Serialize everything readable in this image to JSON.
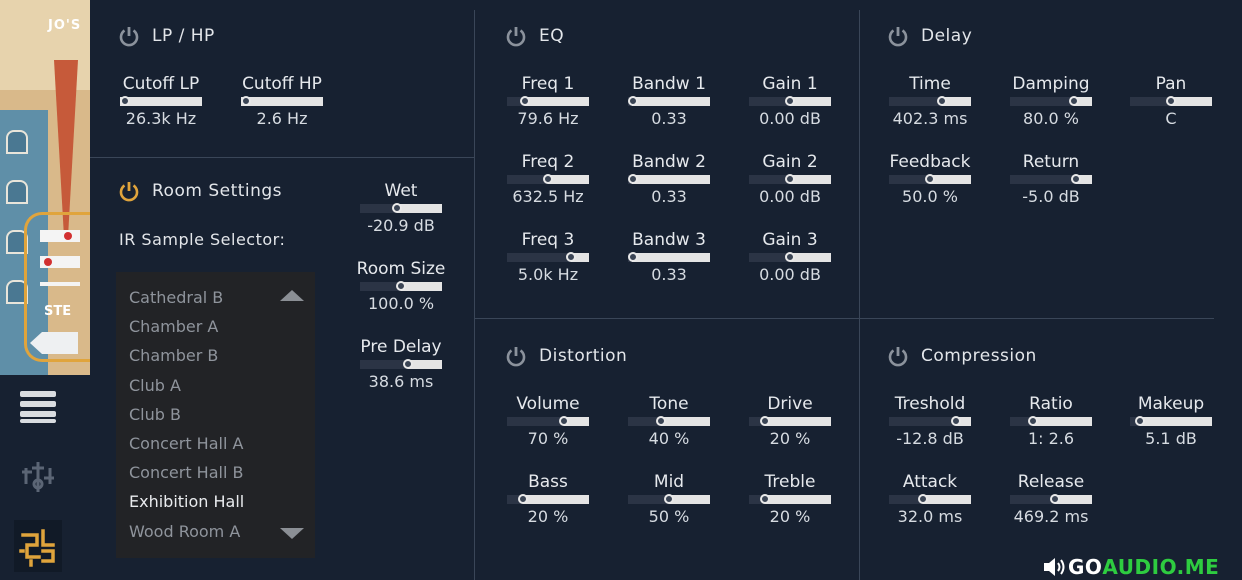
{
  "artwork": {
    "top_text": "JO'S",
    "sign_text": "STE"
  },
  "lp_hp": {
    "title": "LP / HP",
    "params": [
      {
        "label": "Cutoff LP",
        "value": "26.3k Hz",
        "level": 0.0
      },
      {
        "label": "Cutoff HP",
        "value": "2.6 Hz",
        "level": 0.0
      }
    ]
  },
  "room": {
    "title": "Room Settings",
    "ir_label": "IR Sample Selector:",
    "ir_items": [
      "Cathedral B",
      "Chamber A",
      "Chamber B",
      "Club A",
      "Club B",
      "Concert Hall A",
      "Concert Hall B",
      "Exhibition Hall",
      "Wood Room A"
    ],
    "ir_selected": "Exhibition Hall",
    "params": [
      {
        "label": "Wet",
        "value": "-20.9 dB",
        "level": 0.45
      },
      {
        "label": "Room Size",
        "value": "100.0 %",
        "level": 0.5
      },
      {
        "label": "Pre Delay",
        "value": "38.6 ms",
        "level": 0.58
      }
    ]
  },
  "eq": {
    "title": "EQ",
    "params": [
      {
        "label": "Freq 1",
        "value": "79.6 Hz",
        "level": 0.22
      },
      {
        "label": "Bandw 1",
        "value": "0.33",
        "level": 0.05
      },
      {
        "label": "Gain 1",
        "value": "0.00 dB",
        "level": 0.5
      },
      {
        "label": "Freq 2",
        "value": "632.5 Hz",
        "level": 0.5
      },
      {
        "label": "Bandw 2",
        "value": "0.33",
        "level": 0.05
      },
      {
        "label": "Gain 2",
        "value": "0.00 dB",
        "level": 0.5
      },
      {
        "label": "Freq 3",
        "value": "5.0k Hz",
        "level": 0.78
      },
      {
        "label": "Bandw 3",
        "value": "0.33",
        "level": 0.05
      },
      {
        "label": "Gain 3",
        "value": "0.00 dB",
        "level": 0.5
      }
    ]
  },
  "delay": {
    "title": "Delay",
    "params": [
      {
        "label": "Time",
        "value": "402.3 ms",
        "level": 0.65
      },
      {
        "label": "Damping",
        "value": "80.0 %",
        "level": 0.78
      },
      {
        "label": "Pan",
        "value": "C",
        "level": 0.5
      },
      {
        "label": "Feedback",
        "value": "50.0 %",
        "level": 0.5
      },
      {
        "label": "Return",
        "value": "-5.0 dB",
        "level": 0.8
      }
    ]
  },
  "distortion": {
    "title": "Distortion",
    "params": [
      {
        "label": "Volume",
        "value": "70 %",
        "level": 0.7
      },
      {
        "label": "Tone",
        "value": "40 %",
        "level": 0.4
      },
      {
        "label": "Drive",
        "value": "20 %",
        "level": 0.2
      },
      {
        "label": "Bass",
        "value": "20 %",
        "level": 0.2
      },
      {
        "label": "Mid",
        "value": "50 %",
        "level": 0.5
      },
      {
        "label": "Treble",
        "value": "20 %",
        "level": 0.2
      }
    ]
  },
  "compression": {
    "title": "Compression",
    "params": [
      {
        "label": "Treshold",
        "value": "-12.8 dB",
        "level": 0.82
      },
      {
        "label": "Ratio",
        "value": "1: 2.6",
        "level": 0.28
      },
      {
        "label": "Makeup",
        "value": "5.1 dB",
        "level": 0.12
      },
      {
        "label": "Attack",
        "value": "32.0 ms",
        "level": 0.42
      },
      {
        "label": "Release",
        "value": "469.2 ms",
        "level": 0.55
      }
    ]
  },
  "watermark": {
    "part1": "GO",
    "part2": "AUDIO.ME"
  },
  "colors": {
    "background": "#172131",
    "power_active": "#e0a43c",
    "power_inactive": "#8b929c"
  }
}
